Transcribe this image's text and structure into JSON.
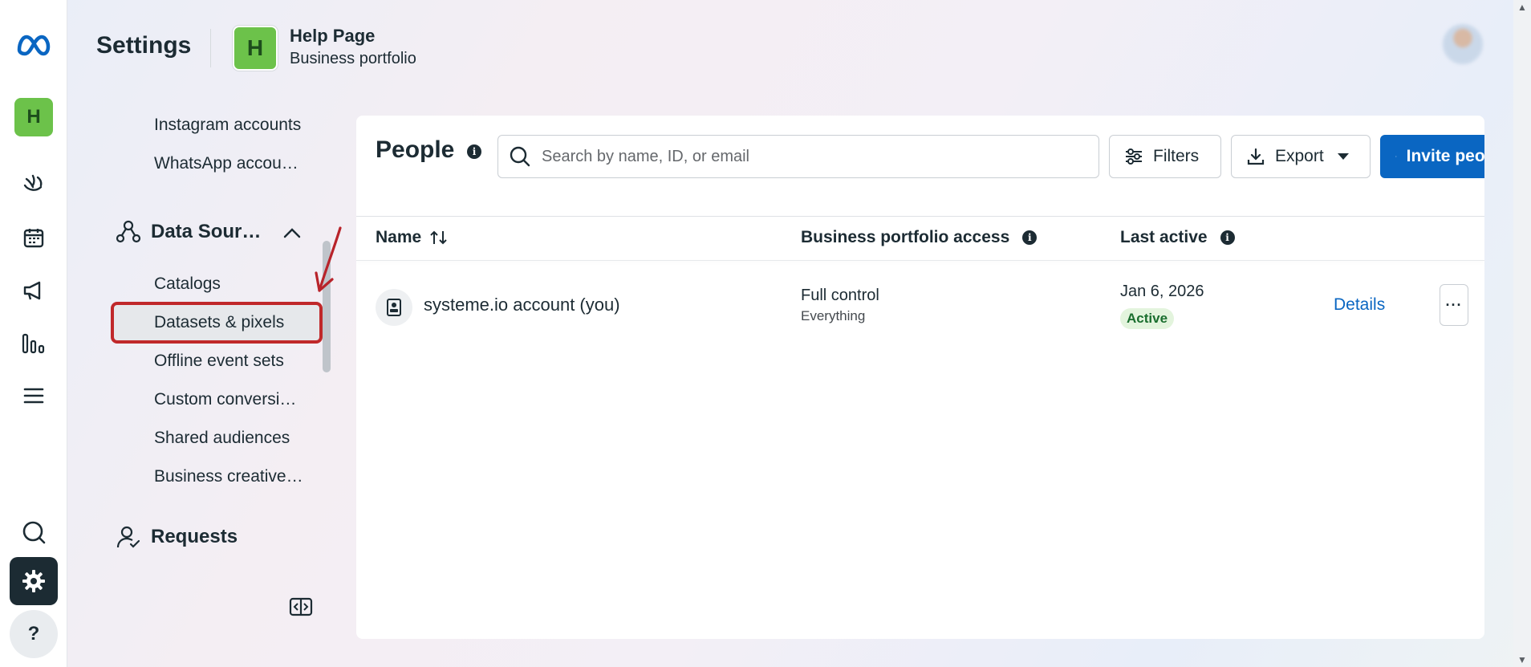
{
  "rail": {
    "business_initial": "H",
    "help_label": "?"
  },
  "header": {
    "title": "Settings",
    "business_initial": "H",
    "business_name": "Help Page",
    "business_type": "Business portfolio"
  },
  "subnav": {
    "top_items": [
      "Instagram accounts",
      "WhatsApp accou…"
    ],
    "data_sources_label": "Data Sour…",
    "data_sources_items": [
      "Catalogs",
      "Datasets & pixels",
      "Offline event sets",
      "Custom conversi…",
      "Shared audiences",
      "Business creative…"
    ],
    "requests_label": "Requests"
  },
  "people": {
    "title": "People",
    "search_placeholder": "Search by name, ID, or email",
    "filters_label": "Filters",
    "export_label": "Export",
    "invite_label": "Invite people",
    "columns": {
      "name": "Name",
      "access": "Business portfolio access",
      "last_active": "Last active"
    },
    "rows": [
      {
        "name": "systeme.io account (you)",
        "access": "Full control",
        "access_detail": "Everything",
        "last_active": "Jan 6, 2026",
        "status": "Active",
        "details_label": "Details"
      }
    ]
  },
  "colors": {
    "accent": "#0a66c2",
    "business_avatar": "#6cc24a",
    "highlight_border": "#c0282a",
    "status_active_bg": "#e3f4dd"
  },
  "icons": [
    "meta-logo",
    "business-suite-icon",
    "calendar-icon",
    "megaphone-icon",
    "insights-icon",
    "menu-icon",
    "search-icon",
    "gear-icon",
    "help-icon",
    "data-sources-icon",
    "requests-icon",
    "collapse-sidebar-icon",
    "info-icon",
    "filters-icon",
    "download-icon",
    "plus-icon",
    "sort-icon",
    "person-badge-icon",
    "more-icon"
  ]
}
